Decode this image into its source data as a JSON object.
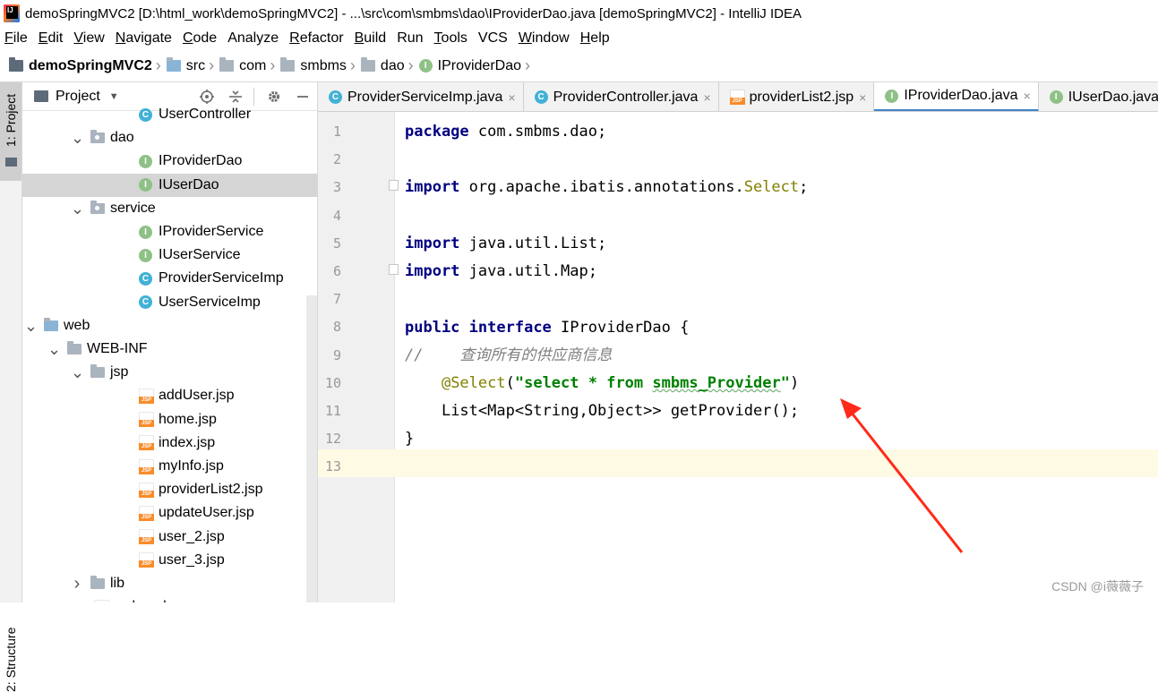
{
  "window": {
    "title": "demoSpringMVC2 [D:\\html_work\\demoSpringMVC2] - ...\\src\\com\\smbms\\dao\\IProviderDao.java [demoSpringMVC2] - IntelliJ IDEA"
  },
  "menu": [
    {
      "label": "File",
      "mnemonic": "F",
      "rest": "ile"
    },
    {
      "label": "Edit",
      "mnemonic": "E",
      "rest": "dit"
    },
    {
      "label": "View",
      "mnemonic": "V",
      "rest": "iew"
    },
    {
      "label": "Navigate",
      "mnemonic": "N",
      "rest": "avigate"
    },
    {
      "label": "Code",
      "mnemonic": "C",
      "rest": "ode"
    },
    {
      "label": "Analyze",
      "mnemonic": "",
      "rest": "Analyze"
    },
    {
      "label": "Refactor",
      "mnemonic": "R",
      "rest": "efactor"
    },
    {
      "label": "Build",
      "mnemonic": "B",
      "rest": "uild"
    },
    {
      "label": "Run",
      "mnemonic": "",
      "rest": "Run"
    },
    {
      "label": "Tools",
      "mnemonic": "T",
      "rest": "ools"
    },
    {
      "label": "VCS",
      "mnemonic": "",
      "rest": "VCS"
    },
    {
      "label": "Window",
      "mnemonic": "W",
      "rest": "indow"
    },
    {
      "label": "Help",
      "mnemonic": "H",
      "rest": "elp"
    }
  ],
  "breadcrumb": {
    "project": "demoSpringMVC2",
    "src": "src",
    "com": "com",
    "smbms": "smbms",
    "dao": "dao",
    "file": "IProviderDao"
  },
  "side_stripe": {
    "project_tab": "1: Project",
    "bottom_tab": "2: Structure"
  },
  "project_panel": {
    "title": "Project",
    "rows": [
      {
        "label": "UserController",
        "icon": "class-icon",
        "arrow": ""
      },
      {
        "label": "dao",
        "icon": "package-icon",
        "arrow": "expanded"
      },
      {
        "label": "IProviderDao",
        "icon": "interface-icon",
        "arrow": ""
      },
      {
        "label": "IUserDao",
        "icon": "interface-icon",
        "arrow": "",
        "selected": true
      },
      {
        "label": "service",
        "icon": "package-icon",
        "arrow": "expanded"
      },
      {
        "label": "IProviderService",
        "icon": "interface-icon",
        "arrow": ""
      },
      {
        "label": "IUserService",
        "icon": "interface-icon",
        "arrow": ""
      },
      {
        "label": "ProviderServiceImp",
        "icon": "class-icon",
        "arrow": ""
      },
      {
        "label": "UserServiceImp",
        "icon": "class-icon",
        "arrow": ""
      },
      {
        "label": "web",
        "icon": "folder-icon",
        "arrow": "expanded"
      },
      {
        "label": "WEB-INF",
        "icon": "folder-icon",
        "arrow": "expanded"
      },
      {
        "label": "jsp",
        "icon": "folder-icon",
        "arrow": "expanded"
      },
      {
        "label": "addUser.jsp",
        "icon": "jsp-icon",
        "arrow": ""
      },
      {
        "label": "home.jsp",
        "icon": "jsp-icon",
        "arrow": ""
      },
      {
        "label": "index.jsp",
        "icon": "jsp-icon",
        "arrow": ""
      },
      {
        "label": "myInfo.jsp",
        "icon": "jsp-icon",
        "arrow": ""
      },
      {
        "label": "providerList2.jsp",
        "icon": "jsp-icon",
        "arrow": ""
      },
      {
        "label": "updateUser.jsp",
        "icon": "jsp-icon",
        "arrow": ""
      },
      {
        "label": "user_2.jsp",
        "icon": "jsp-icon",
        "arrow": ""
      },
      {
        "label": "user_3.jsp",
        "icon": "jsp-icon",
        "arrow": ""
      },
      {
        "label": "lib",
        "icon": "folder-icon",
        "arrow": "collapsed"
      },
      {
        "label": "web.xml",
        "icon": "xml-icon",
        "arrow": ""
      }
    ]
  },
  "tabs": [
    {
      "label": "ProviderServiceImp.java",
      "icon": "class-icon",
      "active": false
    },
    {
      "label": "ProviderController.java",
      "icon": "class-icon",
      "active": false
    },
    {
      "label": "providerList2.jsp",
      "icon": "jsp-icon",
      "active": false
    },
    {
      "label": "IProviderDao.java",
      "icon": "interface-icon",
      "active": true
    },
    {
      "label": "IUserDao.java",
      "icon": "interface-icon",
      "active": false
    }
  ],
  "editor": {
    "line_numbers": [
      "1",
      "2",
      "3",
      "4",
      "5",
      "6",
      "7",
      "8",
      "9",
      "10",
      "11",
      "12",
      "13"
    ],
    "lines": {
      "l1_kw": "package",
      "l1_rest": " com.smbms.dao;",
      "l3_kw": "import",
      "l3_a": " org.apache.ibatis.annotations.",
      "l3_b": "Select",
      "l3_c": ";",
      "l5_kw": "import",
      "l5_rest": " java.util.List;",
      "l6_kw": "import",
      "l6_rest": " java.util.Map;",
      "l8_kw1": "public",
      "l8_kw2": "interface",
      "l8_rest": " IProviderDao {",
      "l9_cmt": "//    查询所有的供应商信息",
      "l10_ann": "@Select",
      "l10_p1": "(",
      "l10_s1": "\"select * from ",
      "l10_s2": "smbms_Provider",
      "l10_s3": "\"",
      "l10_p2": ")",
      "l11": "List<Map<String,Object>> getProvider();",
      "l12": "}"
    }
  },
  "watermark": "CSDN @i薇薇子"
}
